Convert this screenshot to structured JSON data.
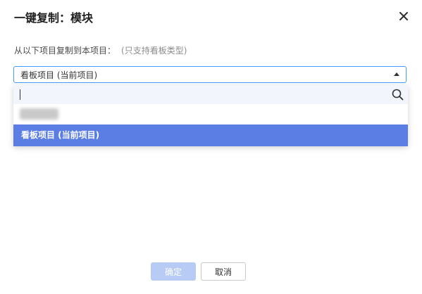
{
  "dialog": {
    "title": "一键复制：模块",
    "close_icon": "close-icon"
  },
  "description": {
    "text": "从以下项目复制到本项目：",
    "hint": "(只支持看板类型)"
  },
  "select": {
    "value": "看板项目 (当前项目)",
    "arrow_icon": "caret-up-icon",
    "border_color": "#409eff"
  },
  "dropdown": {
    "search": {
      "value": "",
      "placeholder": "",
      "icon": "search-icon"
    },
    "options": [
      {
        "label": "",
        "blurred": true
      },
      {
        "label": "看板项目 (当前项目)",
        "selected": true
      }
    ],
    "highlight_color": "#5b7ee5"
  },
  "footer": {
    "confirm_label": "确定",
    "cancel_label": "取消",
    "confirm_color": "#b8cbf4"
  }
}
